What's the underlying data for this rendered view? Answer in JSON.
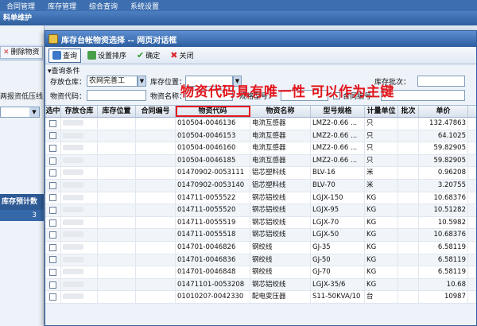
{
  "bg": {
    "menu": [
      "合同管理",
      "库存管理",
      "综合查询",
      "系统设置"
    ],
    "title": "料单维护",
    "delete_btn": "删除物资",
    "warn_text": "两报资低压线",
    "grid_header": "库存预计数",
    "grid_value": "3"
  },
  "dialog": {
    "title": "库存台帐物资选择 -- 网页对话框",
    "toolbar": {
      "query": "查询",
      "sort": "设置排序",
      "ok": "确定",
      "close": "关闭"
    },
    "conditions": {
      "legend": "查询条件",
      "warehouse_label": "存放仓库：",
      "warehouse_value": "农网完善工",
      "location_label": "库存位置：",
      "code_label": "物资代码：",
      "name_label": "物资名称：",
      "type_label": "规格型号：",
      "batch_label": "库存批次：",
      "contract_label": "合同编号"
    },
    "annotation": "物资代码具有唯一性  可以作为主键",
    "columns": [
      "选中",
      "存放仓库",
      "库存位置",
      "合同编号",
      "物资代码",
      "物资名称",
      "型号规格",
      "计量单位",
      "批次",
      "单价"
    ],
    "rows": [
      {
        "code": "010504-0046136",
        "name": "电流互感器",
        "spec": "LMZ2-0.66 ...",
        "unit": "只",
        "price": "132.47863"
      },
      {
        "code": "010504-0046153",
        "name": "电流互感器",
        "spec": "LMZ2-0.66 ...",
        "unit": "只",
        "price": "64.1025"
      },
      {
        "code": "010504-0046160",
        "name": "电流互感器",
        "spec": "LMZ2-0.66 ...",
        "unit": "只",
        "price": "59.82905"
      },
      {
        "code": "010504-0046185",
        "name": "电流互感器",
        "spec": "LMZ2-0.66 ...",
        "unit": "只",
        "price": "59.82905"
      },
      {
        "code": "01470902-0053111",
        "name": "铝芯塑料线",
        "spec": "BLV-16",
        "unit": "米",
        "price": "0.96208"
      },
      {
        "code": "01470902-0053140",
        "name": "铝芯塑料线",
        "spec": "BLV-70",
        "unit": "米",
        "price": "3.20755"
      },
      {
        "code": "014711-0055522",
        "name": "钢芯铝绞线",
        "spec": "LGJX-150",
        "unit": "KG",
        "price": "10.68376"
      },
      {
        "code": "014711-0055520",
        "name": "钢芯铝绞线",
        "spec": "LGJX-95",
        "unit": "KG",
        "price": "10.51282"
      },
      {
        "code": "014711-0055519",
        "name": "钢芯铝绞线",
        "spec": "LGJX-70",
        "unit": "KG",
        "price": "10.5982"
      },
      {
        "code": "014711-0055518",
        "name": "钢芯铝绞线",
        "spec": "LGJX-50",
        "unit": "KG",
        "price": "10.68376"
      },
      {
        "code": "014701-0046826",
        "name": "钢绞线",
        "spec": "GJ-35",
        "unit": "KG",
        "price": "6.58119"
      },
      {
        "code": "014701-0046836",
        "name": "钢绞线",
        "spec": "GJ-50",
        "unit": "KG",
        "price": "6.58119"
      },
      {
        "code": "014701-0046848",
        "name": "钢绞线",
        "spec": "GJ-70",
        "unit": "KG",
        "price": "6.58119"
      },
      {
        "code": "01471101-0053208",
        "name": "钢芯铝绞线",
        "spec": "LGJX-35/6",
        "unit": "KG",
        "price": "10.68"
      },
      {
        "code": "0101020?-0042330",
        "name": "配电变压器",
        "spec": "S11-50KVA/10",
        "unit": "台",
        "price": "10987"
      }
    ]
  }
}
